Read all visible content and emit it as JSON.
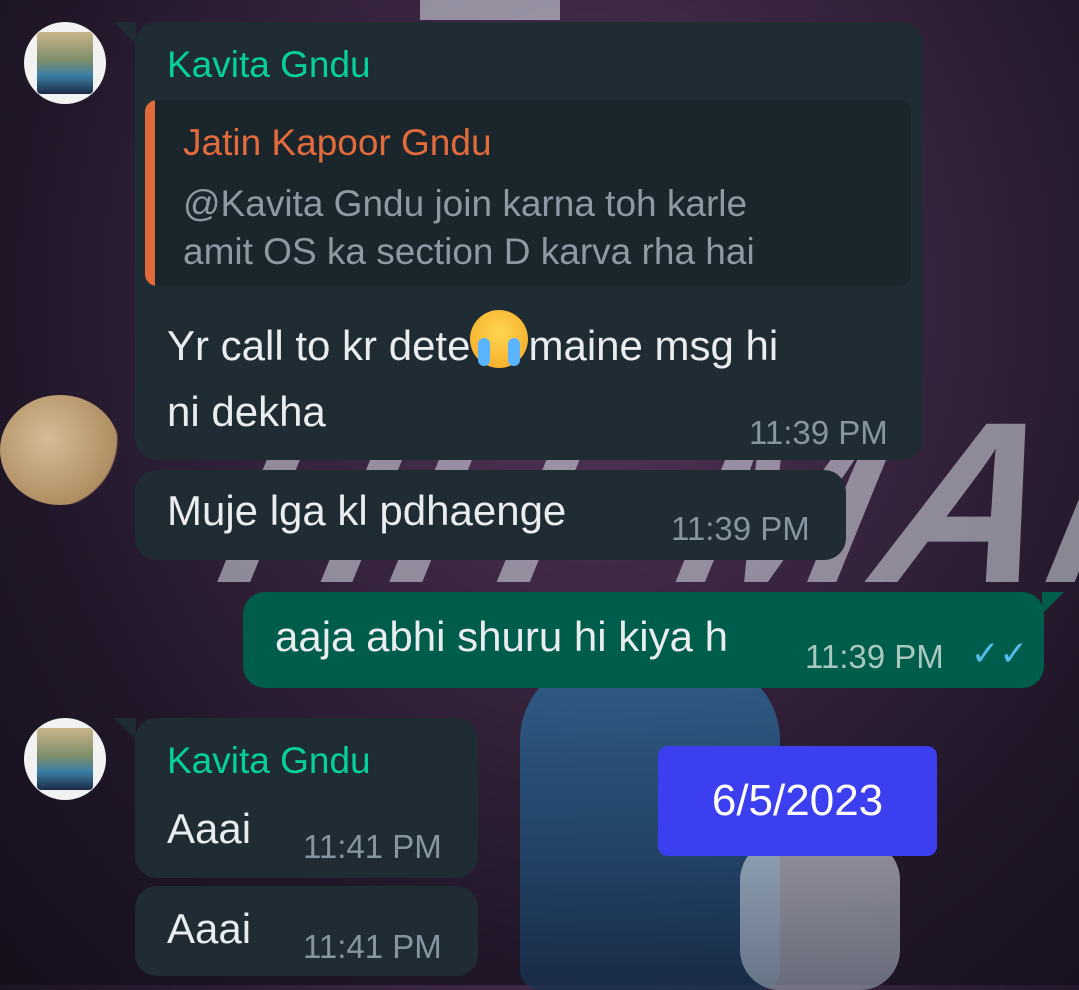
{
  "messages": {
    "m1": {
      "sender": "Kavita Gndu",
      "quote_name": "Jatin Kapoor Gndu",
      "quote_line1": "@Kavita Gndu join karna toh karle",
      "quote_line2": "amit OS ka section D karva rha hai",
      "text_before_emoji": "Yr call to kr dete",
      "text_after_emoji": "maine msg hi",
      "text_line2": "ni dekha",
      "time": "11:39 PM"
    },
    "m2": {
      "text": "Muje lga  kl pdhaenge",
      "time": "11:39 PM"
    },
    "m3": {
      "text": "aaja abhi shuru hi kiya h",
      "time": "11:39 PM",
      "status": "read"
    },
    "m4": {
      "sender": "Kavita Gndu",
      "text": "Aaai",
      "time": "11:41 PM"
    },
    "m5": {
      "text": "Aaai",
      "time": "11:41 PM"
    }
  },
  "date_badge": "6/5/2023",
  "icons": {
    "emoji": "loudly-crying-face-icon",
    "read_receipt": "double-check-icon",
    "avatar": "contact-avatar-icon"
  },
  "colors": {
    "incoming_bubble": "#1f2c34",
    "outgoing_bubble": "#005c4b",
    "sender_name": "#06cf9c",
    "quote_accent": "#e26b3c",
    "date_badge": "#3b3ff0",
    "read_ticks": "#53bdeb"
  }
}
